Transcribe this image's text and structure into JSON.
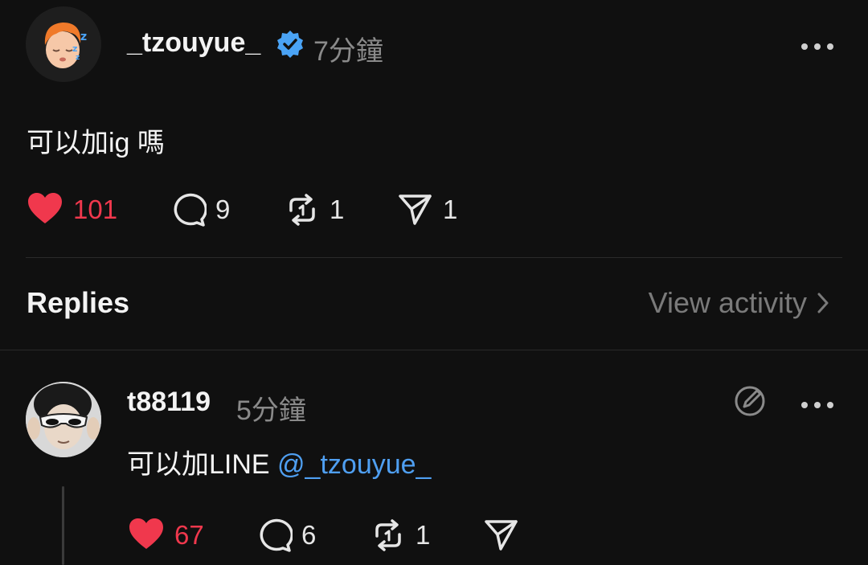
{
  "post": {
    "username": "_tzouyue_",
    "time": "7分鐘",
    "text": "可以加ig 嗎",
    "likes": "101",
    "comments": "9",
    "reposts": "1",
    "shares": "1"
  },
  "replies_section": {
    "title": "Replies",
    "view_activity": "View activity"
  },
  "reply": {
    "username": "t88119",
    "time": "5分鐘",
    "text": "可以加LINE ",
    "mention": "@_tzouyue_",
    "likes": "67",
    "comments": "6",
    "reposts": "1"
  },
  "colors": {
    "background": "#101010",
    "like_red": "#f0384d",
    "verified_blue": "#4aa3f5",
    "mention_blue": "#4f9ff1",
    "muted": "#8a8a8a"
  },
  "icons": [
    "heart-icon",
    "comment-icon",
    "repost-icon",
    "share-icon",
    "verified-icon",
    "more-icon",
    "edit-reply-icon",
    "chevron-right-icon"
  ]
}
